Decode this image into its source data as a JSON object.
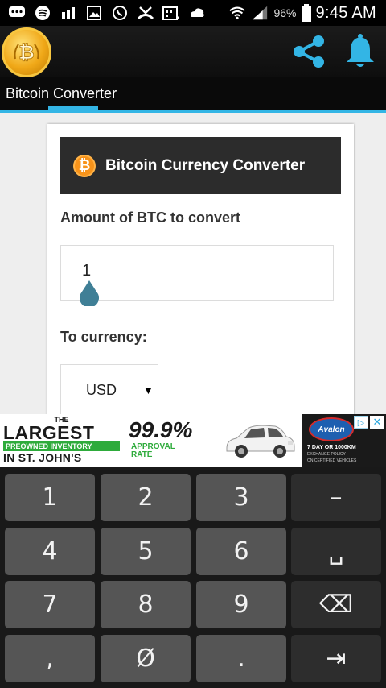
{
  "status_bar": {
    "battery_percent": "96%",
    "time": "9:45 AM",
    "icons": [
      "chat-icon",
      "spotify-icon",
      "brightness-icon",
      "image-icon",
      "whatsapp-icon",
      "missed-call-icon",
      "calendar-icon",
      "cloud-icon",
      "wifi-icon",
      "signal-icon",
      "battery-icon"
    ]
  },
  "app_bar": {
    "logo_icon": "bitcoin-logo-icon",
    "actions": [
      "share-icon",
      "bell-icon"
    ]
  },
  "tabs": [
    {
      "label": "Bitcoin Converter",
      "active": true
    }
  ],
  "converter": {
    "header_title": "Bitcoin Currency Converter",
    "amount_label": "Amount of BTC to convert",
    "amount_value": "1",
    "currency_label": "To currency:",
    "currency_selected": "USD"
  },
  "ad": {
    "the": "THE",
    "largest": "LARGEST",
    "preowned": "PREOWNED INVENTORY",
    "city": "IN ST. JOHN'S",
    "percent": "99.9%",
    "approval": "APPROVAL",
    "rate": "RATE",
    "brand": "Avalon",
    "day_offer": "7 DAY OR 1000KM",
    "policy_line1": "EXCHANGE POLICY",
    "policy_line2": "ON CERTIFIED VEHICLES",
    "choices_symbol": "▷",
    "close_symbol": "✕"
  },
  "keyboard": {
    "row1": [
      "1",
      "2",
      "3",
      "–"
    ],
    "row2": [
      "4",
      "5",
      "6",
      "␣"
    ],
    "row3": [
      "7",
      "8",
      "9",
      "⌫"
    ],
    "row4": [
      ",",
      "Ø",
      ".",
      "⇥"
    ]
  },
  "colors": {
    "accent": "#33b5e5",
    "bitcoin": "#f7931a",
    "header_bg": "#2c2c2c",
    "keyboard_bg": "#191919"
  }
}
